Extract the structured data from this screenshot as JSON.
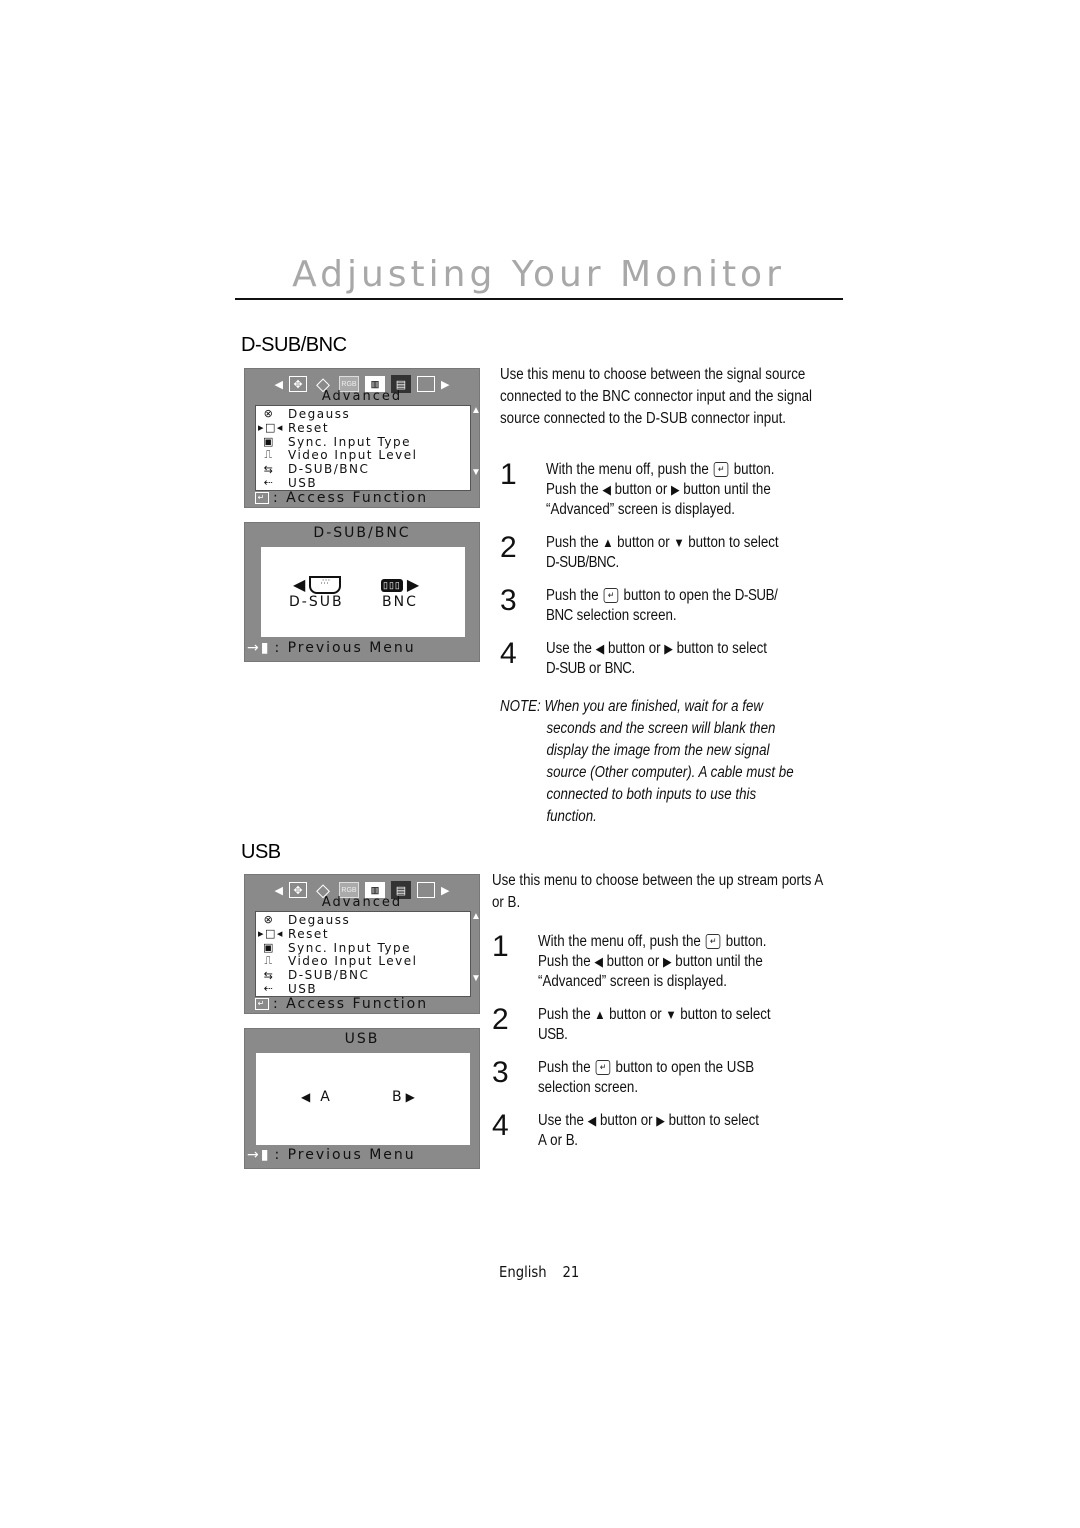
{
  "page": {
    "title": "Adjusting Your Monitor",
    "footer_language": "English",
    "footer_page_number": "21"
  },
  "osd_advanced": {
    "nav_icons": [
      "left-arrow-icon",
      "position-icon",
      "geometry-icon",
      "rgb-icon",
      "moire-icon",
      "advanced-icon",
      "window-icon",
      "right-arrow-icon"
    ],
    "rgb_label": "RGB",
    "title": "Advanced",
    "items": [
      {
        "label": "Degauss",
        "icon": "degauss-icon"
      },
      {
        "label": "Reset",
        "icon": "reset-icon"
      },
      {
        "label": "Sync. Input Type",
        "icon": "sync-input-type-icon"
      },
      {
        "label": "Video Input Level",
        "icon": "video-input-level-icon"
      },
      {
        "label": "D-SUB/BNC",
        "icon": "dsub-bnc-icon"
      },
      {
        "label": "USB",
        "icon": "usb-icon"
      }
    ],
    "footer": ": Access Function"
  },
  "sections": {
    "dsub_bnc": {
      "heading": "D-SUB/BNC",
      "intro": "Use this menu to choose between the signal source connected to the BNC connector input and the signal source connected to the D-SUB connector input.",
      "screen": {
        "title": "D-SUB/BNC",
        "left_option": "D-SUB",
        "right_option": "BNC",
        "footer": ": Previous Menu"
      },
      "steps": [
        {
          "num": "1",
          "a": "With the menu off, push the",
          "b": "button.",
          "c": "Push the",
          "d": "button or",
          "e": "button until the",
          "f": "“Advanced” screen is displayed."
        },
        {
          "num": "2",
          "a": "Push the",
          "b": "button or",
          "c": "button to select",
          "term": "D-SUB/BNC."
        },
        {
          "num": "3",
          "a": "Push the",
          "b": "button to open the",
          "term1": "D-SUB/",
          "term2": "BNC",
          "c": "selection screen."
        },
        {
          "num": "4",
          "a": "Use the",
          "b": "button or",
          "c": "button to select",
          "term1": "D-SUB",
          "mid": "or",
          "term2": "BNC."
        }
      ],
      "note": {
        "label": "NOTE:",
        "lines": [
          "When you are finished, wait for a few",
          "seconds and the screen will blank then",
          "display the image from the new signal",
          "source (Other computer). A cable must be",
          "connected to both inputs to use this",
          "function."
        ]
      }
    },
    "usb": {
      "heading": "USB",
      "intro": "Use this menu to choose between the up stream ports A or B.",
      "screen": {
        "title": "USB",
        "left_option": "A",
        "right_option": "B",
        "footer": ": Previous Menu"
      },
      "steps": [
        {
          "num": "1",
          "a": "With the menu off, push the",
          "b": "button.",
          "c": "Push the",
          "d": "button or",
          "e": "button until the",
          "f": "“Advanced” screen is displayed."
        },
        {
          "num": "2",
          "a": "Push the",
          "b": "button or",
          "c": "button to select",
          "term": "USB."
        },
        {
          "num": "3",
          "a": "Push the",
          "b": "button to open the USB",
          "c": "selection screen."
        },
        {
          "num": "4",
          "a": "Use the",
          "b": "button or",
          "c": "button to select",
          "term1": "A",
          "mid": "or",
          "term2": "B."
        }
      ]
    }
  }
}
